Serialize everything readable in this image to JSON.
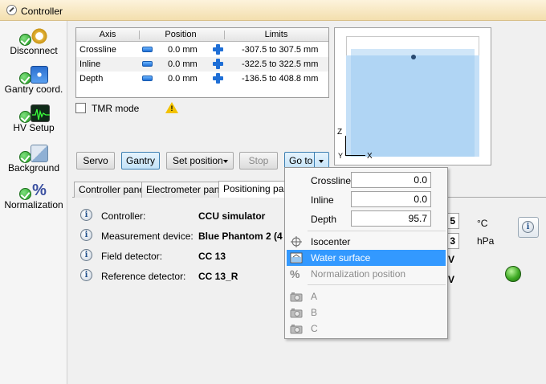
{
  "window": {
    "title": "Controller"
  },
  "toolbar": [
    {
      "label": "Disconnect",
      "icon": "plug-icon"
    },
    {
      "label": "Gantry coord.",
      "icon": "coordinate-icon"
    },
    {
      "label": "HV Setup",
      "icon": "waveform-icon"
    },
    {
      "label": "Background",
      "icon": "cube-icon"
    },
    {
      "label": "Normalization",
      "icon": "percent-icon"
    }
  ],
  "axis_table": {
    "headers": [
      "Axis",
      "Position",
      "Limits"
    ],
    "rows": [
      {
        "axis": "Crossline",
        "position": "0.0 mm",
        "limits": "-307.5 to 307.5 mm"
      },
      {
        "axis": "Inline",
        "position": "0.0 mm",
        "limits": "-322.5 to 322.5 mm"
      },
      {
        "axis": "Depth",
        "position": "0.0 mm",
        "limits": "-136.5 to 408.8 mm"
      }
    ]
  },
  "tmr": {
    "label": "TMR mode",
    "checked": false
  },
  "tank_view": {
    "axis_z": "Z",
    "axis_y": "Y",
    "axis_x": "X"
  },
  "buttons": {
    "servo": "Servo",
    "gantry": "Gantry",
    "set_position": "Set position",
    "stop": "Stop",
    "go_to": "Go to"
  },
  "tabs": [
    "Controller panel",
    "Electrometer panel",
    "Positioning panel"
  ],
  "info": [
    {
      "label": "Controller:",
      "value": "CCU simulator"
    },
    {
      "label": "Measurement device:",
      "value": "Blue Phantom 2  (4"
    },
    {
      "label": "Field detector:",
      "value": "CC 13"
    },
    {
      "label": "Reference detector:",
      "value": "CC 13_R"
    }
  ],
  "environment": {
    "temp_partial": "5",
    "temp_unit": "°C",
    "pressure_partial": "3",
    "pressure_unit": "hPa",
    "v1": "V",
    "v2": "V"
  },
  "goto_menu": {
    "fields": [
      {
        "label": "Crossline",
        "value": "0.0"
      },
      {
        "label": "Inline",
        "value": "0.0"
      },
      {
        "label": "Depth",
        "value": "95.7"
      }
    ],
    "items": [
      {
        "label": "Isocenter",
        "icon": "isocenter-icon",
        "enabled": true,
        "highlighted": false
      },
      {
        "label": "Water surface",
        "icon": "water-surface-icon",
        "enabled": true,
        "highlighted": true
      },
      {
        "label": "Normalization position",
        "icon": "percent-icon",
        "enabled": false,
        "highlighted": false
      }
    ],
    "positions": [
      {
        "label": "A",
        "icon": "camera-position-icon"
      },
      {
        "label": "B",
        "icon": "camera-position-icon"
      },
      {
        "label": "C",
        "icon": "camera-position-icon"
      }
    ]
  },
  "colors": {
    "highlight": "#3399ff",
    "active_button": "#c4e3f8",
    "status_led": "#3faa24",
    "water": "#c5e0f7"
  }
}
